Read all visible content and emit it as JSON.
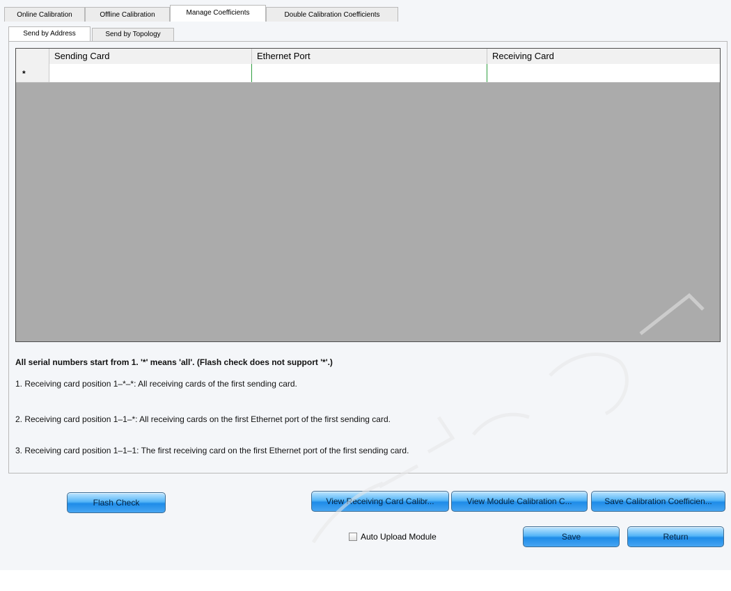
{
  "tabs": [
    {
      "label": "Online Calibration",
      "active": false
    },
    {
      "label": "Offline Calibration",
      "active": false
    },
    {
      "label": "Manage Coefficients",
      "active": true
    },
    {
      "label": "Double Calibration Coefficients",
      "active": false
    }
  ],
  "subtabs": [
    {
      "label": "Send by Address",
      "active": true
    },
    {
      "label": "Send by Topology",
      "active": false
    }
  ],
  "grid": {
    "columns": [
      "Sending Card",
      "Ethernet Port",
      "Receiving Card"
    ],
    "new_row_marker": "*"
  },
  "notes": {
    "heading": "All serial numbers start from 1. '*' means 'all'. (Flash check does not support '*'.)",
    "line1": "1. Receiving card position 1–*–*: All receiving cards of the first sending card.",
    "line2": "2. Receiving card position 1–1–*: All receiving cards on the first Ethernet port of the first sending card.",
    "line3": "3. Receiving card position 1–1–1: The first receiving card on the first Ethernet port of the first sending card."
  },
  "buttons": {
    "flash_check": "Flash Check",
    "view_receiving": "View Receiving Card Calibr...",
    "view_module": "View Module Calibration C...",
    "save_coefficients": "Save Calibration Coefficien...",
    "save": "Save",
    "return": "Return"
  },
  "auto_upload": {
    "label": "Auto Upload Module",
    "checked": false
  },
  "colors": {
    "accent_button": "#1e8be8",
    "grid_empty": "#ababab",
    "cell_border": "#2f9e3f"
  }
}
